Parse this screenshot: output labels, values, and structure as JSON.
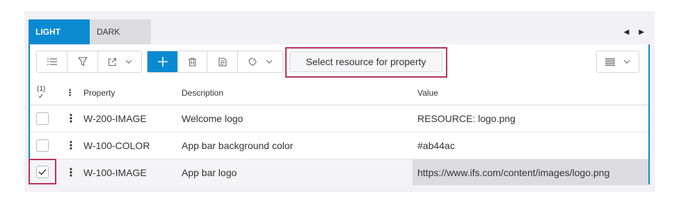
{
  "tabs": [
    {
      "label": "LIGHT",
      "active": true
    },
    {
      "label": "DARK",
      "active": false
    }
  ],
  "toolbar": {
    "select_resource_label": "Select resource for property"
  },
  "table": {
    "selected_count": "(1)",
    "headers": {
      "property": "Property",
      "description": "Description",
      "value": "Value"
    },
    "rows": [
      {
        "property": "W-200-IMAGE",
        "description": "Welcome logo",
        "value": "RESOURCE: logo.png",
        "checked": false
      },
      {
        "property": "W-100-COLOR",
        "description": "App bar background color",
        "value": "#ab44ac",
        "checked": false
      },
      {
        "property": "W-100-IMAGE",
        "description": "App bar logo",
        "value": "https://www.ifs.com/content/images/logo.png",
        "checked": true
      }
    ]
  },
  "colors": {
    "accent": "#0a8ad1",
    "highlight": "#b8325a",
    "selected_row": "#dcdbe0"
  },
  "icons": [
    "list-icon",
    "filter-icon",
    "export-icon",
    "chevron-down-icon",
    "plus-icon",
    "trash-icon",
    "duplicate-icon",
    "tag-icon",
    "density-icon",
    "caret-left-icon",
    "caret-right-icon",
    "kebab-icon",
    "checkmark-icon"
  ]
}
